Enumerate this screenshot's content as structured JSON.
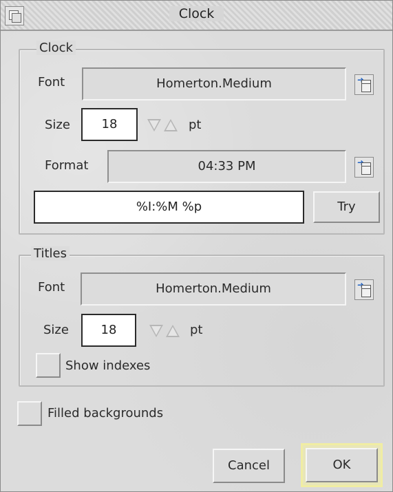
{
  "window": {
    "title": "Clock"
  },
  "clock_group": {
    "label": "Clock",
    "font_label": "Font",
    "font_value": "Homerton.Medium",
    "size_label": "Size",
    "size_value": "18",
    "size_unit": "pt",
    "format_label": "Format",
    "format_preview": "04:33 PM",
    "format_string": "%I:%M %p",
    "try_label": "Try"
  },
  "titles_group": {
    "label": "Titles",
    "font_label": "Font",
    "font_value": "Homerton.Medium",
    "size_label": "Size",
    "size_value": "18",
    "size_unit": "pt",
    "show_indexes_label": "Show indexes"
  },
  "filled_backgrounds_label": "Filled backgrounds",
  "buttons": {
    "cancel": "Cancel",
    "ok": "OK"
  },
  "colors": {
    "default_button_ring": "#f0eda3",
    "menu_arrow": "#1a5fc4"
  }
}
